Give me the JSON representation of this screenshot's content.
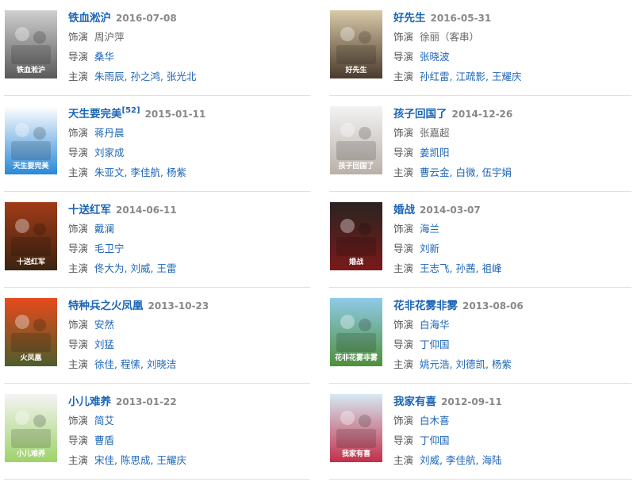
{
  "labels": {
    "role": "饰演",
    "director": "导演",
    "cast": "主演"
  },
  "items": [
    {
      "title": "铁血淞沪",
      "date": "2016-07-08",
      "role": "周沪萍",
      "role_linked": false,
      "director": "桑华",
      "cast": [
        "朱雨辰",
        "孙之鸿",
        "张光北"
      ],
      "poster_text": "铁血淞沪",
      "poster_colors": [
        "#cfcfcf",
        "#5a5a5a"
      ]
    },
    {
      "title": "好先生",
      "date": "2016-05-31",
      "role": "徐丽（客串）",
      "role_linked": false,
      "director": "张晓波",
      "cast": [
        "孙红雷",
        "江疏影",
        "王耀庆"
      ],
      "poster_text": "好先生",
      "poster_colors": [
        "#d8c9a8",
        "#4a3a2c"
      ]
    },
    {
      "title": "天生要完美",
      "sup": "[52]",
      "date": "2015-01-11",
      "role": "蒋丹晨",
      "role_linked": true,
      "director": "刘家成",
      "cast": [
        "朱亚文",
        "李佳航",
        "杨紫"
      ],
      "poster_text": "天生要完美",
      "poster_colors": [
        "#ffffff",
        "#2a88d6"
      ]
    },
    {
      "title": "孩子回国了",
      "date": "2014-12-26",
      "role": "张嘉超",
      "role_linked": false,
      "director": "姜凯阳",
      "cast": [
        "曹云金",
        "白微",
        "伍宇娟"
      ],
      "poster_text": "孩子回国了",
      "poster_colors": [
        "#f3f3f3",
        "#b9b0a8"
      ]
    },
    {
      "title": "十送红军",
      "date": "2014-06-11",
      "role": "戴澜",
      "role_linked": true,
      "director": "毛卫宁",
      "cast": [
        "佟大为",
        "刘威",
        "王雷"
      ],
      "poster_text": "十送红军",
      "poster_colors": [
        "#a13b18",
        "#3b2410"
      ]
    },
    {
      "title": "婚战",
      "date": "2014-03-07",
      "role": "海兰",
      "role_linked": true,
      "director": "刘新",
      "cast": [
        "王志飞",
        "孙茜",
        "祖峰"
      ],
      "poster_text": "婚战",
      "poster_colors": [
        "#2a2420",
        "#7a1a1a"
      ]
    },
    {
      "title": "特种兵之火凤凰",
      "date": "2013-10-23",
      "role": "安然",
      "role_linked": true,
      "director": "刘猛",
      "cast": [
        "徐佳",
        "程愫",
        "刘晓洁"
      ],
      "poster_text": "火凤凰",
      "poster_colors": [
        "#e64a1c",
        "#4d5d2c"
      ]
    },
    {
      "title": "花非花雾非雾",
      "date": "2013-08-06",
      "role": "白海华",
      "role_linked": true,
      "director": "丁仰国",
      "cast": [
        "姚元浩",
        "刘德凯",
        "杨紫"
      ],
      "poster_text": "花非花雾非雾",
      "poster_colors": [
        "#8fcbe8",
        "#4f8f3a"
      ]
    },
    {
      "title": "小儿难养",
      "date": "2013-01-22",
      "role": "简艾",
      "role_linked": true,
      "director": "曹盾",
      "cast": [
        "宋佳",
        "陈思成",
        "王耀庆"
      ],
      "poster_text": "小儿难养",
      "poster_colors": [
        "#f4f4f4",
        "#9fd26a"
      ]
    },
    {
      "title": "我家有喜",
      "date": "2012-09-11",
      "role": "白木喜",
      "role_linked": true,
      "director": "丁仰国",
      "cast": [
        "刘威",
        "李佳航",
        "海陆"
      ],
      "poster_text": "我家有喜",
      "poster_colors": [
        "#d6e9f2",
        "#c22f4a"
      ]
    }
  ]
}
